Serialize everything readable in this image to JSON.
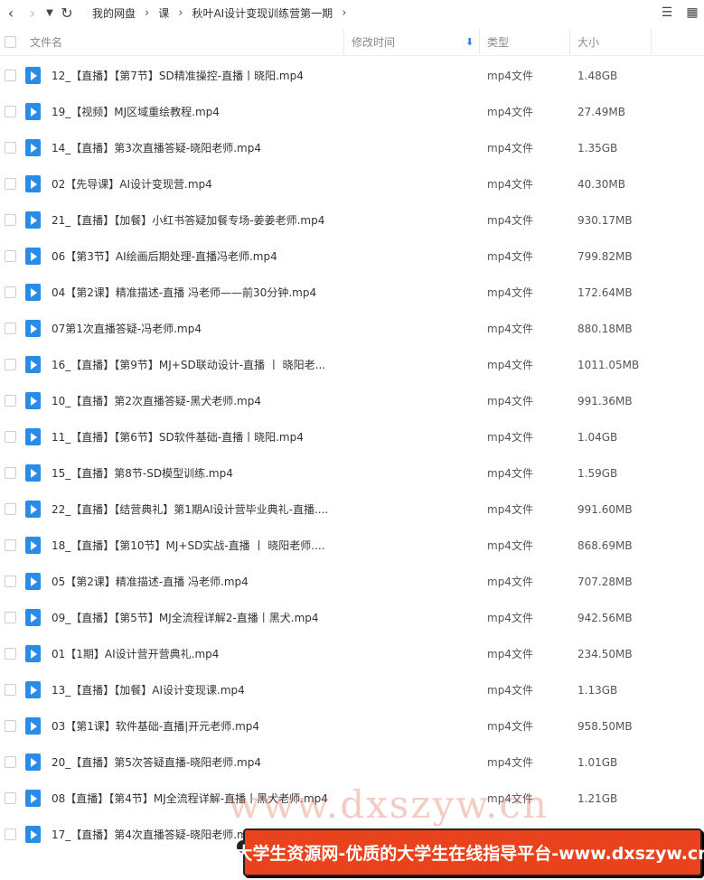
{
  "nav": {
    "back_icon": "chevron-left-icon",
    "forward_icon": "chevron-right-icon",
    "dropdown_icon": "caret-down-icon",
    "refresh_icon": "refresh-icon",
    "breadcrumb": [
      "我的网盘",
      "课",
      "秋叶AI设计变现训练营第一期"
    ]
  },
  "toolbar": {
    "sort_icon": "sort-icon",
    "grid_icon": "grid-view-icon"
  },
  "columns": {
    "name": "文件名",
    "modified": "修改时间",
    "type": "类型",
    "size": "大小"
  },
  "files": [
    {
      "name": "12_【直播】【第7节】SD精准操控-直播丨晓阳.mp4",
      "type": "mp4文件",
      "size": "1.48GB"
    },
    {
      "name": "19_【视频】MJ区域重绘教程.mp4",
      "type": "mp4文件",
      "size": "27.49MB"
    },
    {
      "name": "14_【直播】第3次直播答疑-晓阳老师.mp4",
      "type": "mp4文件",
      "size": "1.35GB"
    },
    {
      "name": "02【先导课】AI设计变现营.mp4",
      "type": "mp4文件",
      "size": "40.30MB"
    },
    {
      "name": "21_【直播】【加餐】小红书答疑加餐专场-姜姜老师.mp4",
      "type": "mp4文件",
      "size": "930.17MB"
    },
    {
      "name": "06【第3节】AI绘画后期处理-直播冯老师.mp4",
      "type": "mp4文件",
      "size": "799.82MB"
    },
    {
      "name": "04【第2课】精准描述-直播 冯老师——前30分钟.mp4",
      "type": "mp4文件",
      "size": "172.64MB"
    },
    {
      "name": "07第1次直播答疑-冯老师.mp4",
      "type": "mp4文件",
      "size": "880.18MB"
    },
    {
      "name": "16_【直播】【第9节】MJ+SD联动设计-直播 丨 晓阳老...",
      "type": "mp4文件",
      "size": "1011.05MB"
    },
    {
      "name": "10_【直播】第2次直播答疑-黑犬老师.mp4",
      "type": "mp4文件",
      "size": "991.36MB"
    },
    {
      "name": "11_【直播】【第6节】SD软件基础-直播丨晓阳.mp4",
      "type": "mp4文件",
      "size": "1.04GB"
    },
    {
      "name": "15_【直播】第8节-SD模型训练.mp4",
      "type": "mp4文件",
      "size": "1.59GB"
    },
    {
      "name": "22_【直播】【结营典礼】第1期AI设计营毕业典礼-直播....",
      "type": "mp4文件",
      "size": "991.60MB"
    },
    {
      "name": "18_【直播】【第10节】MJ+SD实战-直播 丨 晓阳老师....",
      "type": "mp4文件",
      "size": "868.69MB"
    },
    {
      "name": "05【第2课】精准描述-直播 冯老师.mp4",
      "type": "mp4文件",
      "size": "707.28MB"
    },
    {
      "name": "09_【直播】【第5节】MJ全流程详解2-直播丨黑犬.mp4",
      "type": "mp4文件",
      "size": "942.56MB"
    },
    {
      "name": "01【1期】AI设计营开营典礼.mp4",
      "type": "mp4文件",
      "size": "234.50MB"
    },
    {
      "name": "13_【直播】【加餐】AI设计变现课.mp4",
      "type": "mp4文件",
      "size": "1.13GB"
    },
    {
      "name": "03【第1课】软件基础-直播|开元老师.mp4",
      "type": "mp4文件",
      "size": "958.50MB"
    },
    {
      "name": "20_【直播】第5次答疑直播-晓阳老师.mp4",
      "type": "mp4文件",
      "size": "1.01GB"
    },
    {
      "name": "08【直播】【第4节】MJ全流程详解-直播丨黑犬老师.mp4",
      "type": "mp4文件",
      "size": "1.21GB"
    },
    {
      "name": "17_【直播】第4次直播答疑-晓阳老师.mp4",
      "type": "",
      "size": ""
    }
  ],
  "watermark": {
    "url_text": "www.dxszyw.cn",
    "banner_text": "大学生资源网-优质的大学生在线指导平台-www.dxszyw.cn"
  }
}
